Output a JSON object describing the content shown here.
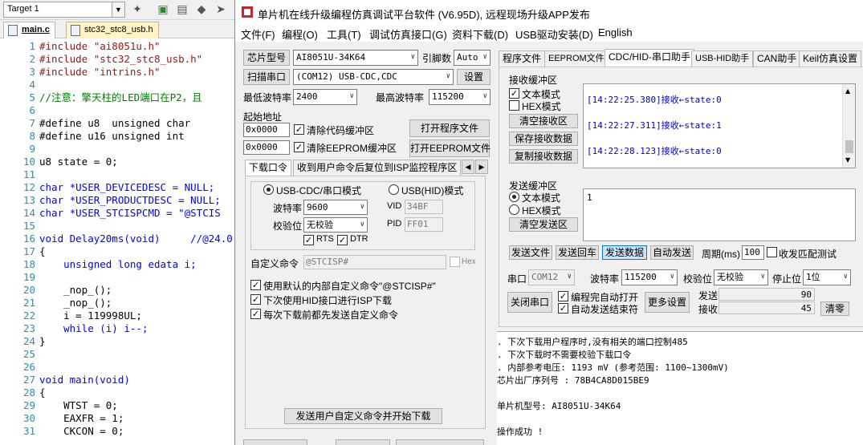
{
  "ide": {
    "target": "Target 1",
    "tabs": [
      "main.c",
      "stc32_stc8_usb.h"
    ],
    "code": [
      {
        "n": "1",
        "t": "#include \"ai8051u.h\""
      },
      {
        "n": "2",
        "t": "#include \"stc32_stc8_usb.h\""
      },
      {
        "n": "3",
        "t": "#include \"intrins.h\""
      },
      {
        "n": "4",
        "t": ""
      },
      {
        "n": "5",
        "t": "//注意：擎天柱的LED端口在P2，且"
      },
      {
        "n": "6",
        "t": ""
      },
      {
        "n": "7",
        "t": "#define u8  unsigned char"
      },
      {
        "n": "8",
        "t": "#define u16 unsigned int"
      },
      {
        "n": "9",
        "t": ""
      },
      {
        "n": "10",
        "t": "u8 state = 0;"
      },
      {
        "n": "11",
        "t": ""
      },
      {
        "n": "12",
        "t": "char *USER_DEVICEDESC = NULL;"
      },
      {
        "n": "13",
        "t": "char *USER_PRODUCTDESC = NULL;"
      },
      {
        "n": "14",
        "t": "char *USER_STCISPCMD = \"@STCIS"
      },
      {
        "n": "15",
        "t": ""
      },
      {
        "n": "16",
        "t": "void Delay20ms(void)     //@24.0"
      },
      {
        "n": "17",
        "t": "{"
      },
      {
        "n": "18",
        "t": "    unsigned long edata i;"
      },
      {
        "n": "19",
        "t": ""
      },
      {
        "n": "20",
        "t": "    _nop_();"
      },
      {
        "n": "21",
        "t": "    _nop_();"
      },
      {
        "n": "22",
        "t": "    i = 119998UL;"
      },
      {
        "n": "23",
        "t": "    while (i) i--;"
      },
      {
        "n": "24",
        "t": "}"
      },
      {
        "n": "25",
        "t": ""
      },
      {
        "n": "26",
        "t": ""
      },
      {
        "n": "27",
        "t": "void main(void)"
      },
      {
        "n": "28",
        "t": "{"
      },
      {
        "n": "29",
        "t": "    WTST = 0;"
      },
      {
        "n": "30",
        "t": "    EAXFR = 1;"
      },
      {
        "n": "31",
        "t": "    CKCON = 0;"
      }
    ]
  },
  "isp": {
    "title": "单片机在线升级编程仿真调试平台软件 (V6.95D), 远程现场升级APP发布",
    "menu": [
      "文件(F)",
      "编程(O)",
      "工具(T)",
      "调试仿真接口(G)",
      "资料下载(D)",
      "USB驱动安装(D)",
      "English"
    ],
    "chip_label": "芯片型号",
    "chip_value": "AI8051U-34K64",
    "pin_label": "引脚数",
    "pin_value": "Auto",
    "scan_label": "扫描串口",
    "port_value": "(COM12) USB-CDC,CDC",
    "settings_label": "设置",
    "min_baud_label": "最低波特率",
    "min_baud_value": "2400",
    "max_baud_label": "最高波特率",
    "max_baud_value": "115200",
    "start_addr_label": "起始地址",
    "addr1": "0x0000",
    "clear_code_label": "清除代码缓冲区",
    "open_prog_label": "打开程序文件",
    "addr2": "0x0000",
    "clear_eeprom_label": "清除EEPROM缓冲区",
    "open_eeprom_label": "打开EEPROM文件",
    "subtab1": "下载口令",
    "subtab2": "收到用户命令后复位到ISP监控程序区",
    "usb_cdc_label": "USB-CDC/串口模式",
    "usb_hid_label": "USB(HID)模式",
    "baud_label": "波特率",
    "baud_value": "9600",
    "parity_label": "校验位",
    "parity_value": "无校验",
    "rts_label": "RTS",
    "dtr_label": "DTR",
    "vid_label": "VID",
    "vid_value": "34BF",
    "pid_label": "PID",
    "pid_value": "FF01",
    "custom_cmd_label": "自定义命令",
    "custom_cmd_value": "@STCISP#",
    "hex_label": "Hex",
    "opt1": "使用默认的内部自定义命令\"@STCISP#\"",
    "opt2": "下次使用HID接口进行ISP下载",
    "opt3": "每次下载前都先发送自定义命令",
    "send_cmd_btn": "发送用户自定义命令并开始下载",
    "right_tabs": [
      "程序文件",
      "EEPROM文件",
      "CDC/HID-串口助手",
      "USB-HID助手",
      "CAN助手",
      "Keil仿真设置"
    ],
    "recv_title": "接收缓冲区",
    "text_mode": "文本模式",
    "hex_mode": "HEX模式",
    "clear_recv": "清空接收区",
    "save_recv": "保存接收数据",
    "copy_recv": "复制接收数据",
    "recv_lines": [
      "[14:22:25.380]接收←state:0",
      "[14:22:27.311]接收←state:1",
      "[14:22:28.123]接收←state:0"
    ],
    "send_title": "发送缓冲区",
    "send_text_mode": "文本模式",
    "send_hex_mode": "HEX模式",
    "clear_send": "清空发送区",
    "send_value": "1",
    "send_file": "发送文件",
    "send_return": "发送回车",
    "send_data": "发送数据",
    "auto_send": "自动发送",
    "period_label": "周期(ms)",
    "period_value": "100",
    "recv_match": "收发匹配测试",
    "com_label": "串口",
    "com_value": "COM12",
    "baud2_label": "波特率",
    "baud2_value": "115200",
    "parity2_label": "校验位",
    "parity2_value": "无校验",
    "stop_label": "停止位",
    "stop_value": "1位",
    "close_port": "关闭串口",
    "auto_open": "编程完自动打开",
    "auto_send_end": "自动发送结束符",
    "more_settings": "更多设置",
    "send_count_label": "发送",
    "send_count": "90",
    "recv_count_label": "接收",
    "recv_count": "45",
    "clear_count": "清零",
    "log": [
      "  . 下次下载用户程序时,没有相关的端口控制485",
      "  . 下次下载时不需要校验下载口令",
      "  . 内部参考电压: 1193 mV (参考范围: 1100~1300mV)",
      "芯片出厂序列号 : 78B4CA8D015BE9",
      "",
      "  单片机型号: AI8051U-34K64",
      "",
      "操作成功 !"
    ]
  }
}
